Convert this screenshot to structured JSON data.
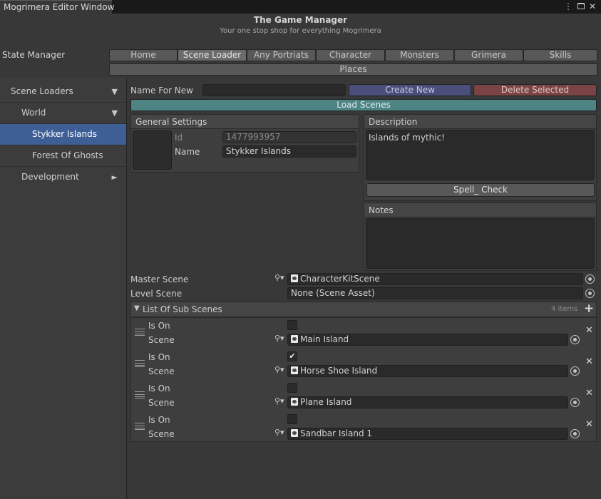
{
  "window": {
    "title": "Mogrimera Editor Window",
    "menu_icon": "kebab-menu-icon",
    "maximize_icon": "maximize-icon",
    "close_icon": "close-icon"
  },
  "header": {
    "title": "The Game Manager",
    "subtitle": "Your one stop shop for everything Mogrimera"
  },
  "state_manager": {
    "label": "State Manager",
    "tabs": [
      "Home",
      "Scene Loader",
      "Any Portriats",
      "Character",
      "Monsters",
      "Grimera",
      "Skills"
    ],
    "active_tab": "Scene Loader",
    "places_label": "Places"
  },
  "sidebar": {
    "items": [
      {
        "label": "Scene Loaders",
        "arrow": "▼"
      },
      {
        "label": "World",
        "arrow": "▼"
      },
      {
        "label": "Stykker Islands",
        "arrow": ""
      },
      {
        "label": "Forest Of Ghosts",
        "arrow": ""
      },
      {
        "label": "Development",
        "arrow": "►"
      }
    ],
    "selected": "Stykker Islands"
  },
  "toolbar": {
    "name_for_new_label": "Name For New",
    "name_for_new_value": "",
    "create_new_label": "Create New",
    "delete_selected_label": "Delete Selected",
    "load_scenes_label": "Load Scenes",
    "create_color": "#4a4e7a",
    "delete_color": "#7a4444",
    "load_color": "#4e8484"
  },
  "general_settings": {
    "title": "General Settings",
    "id_label": "Id",
    "id_value": "1477993957",
    "name_label": "Name",
    "name_value": "Stykker Islands"
  },
  "description": {
    "title": "Description",
    "text": "Islands of mythic!",
    "spell_check_label": "Spell_ Check"
  },
  "notes": {
    "title": "Notes",
    "text": ""
  },
  "scenes": {
    "master_label": "Master Scene",
    "master_value": "CharacterKitScene",
    "level_label": "Level Scene",
    "level_value": "None (Scene Asset)"
  },
  "sub_scenes": {
    "title": "List Of Sub Scenes",
    "count_label": "4 items",
    "is_on_label": "Is On",
    "scene_label": "Scene",
    "items": [
      {
        "is_on": false,
        "scene": "Main Island"
      },
      {
        "is_on": true,
        "scene": "Horse Shoe Island"
      },
      {
        "is_on": false,
        "scene": "Plane Island"
      },
      {
        "is_on": false,
        "scene": "Sandbar Island 1"
      }
    ]
  }
}
